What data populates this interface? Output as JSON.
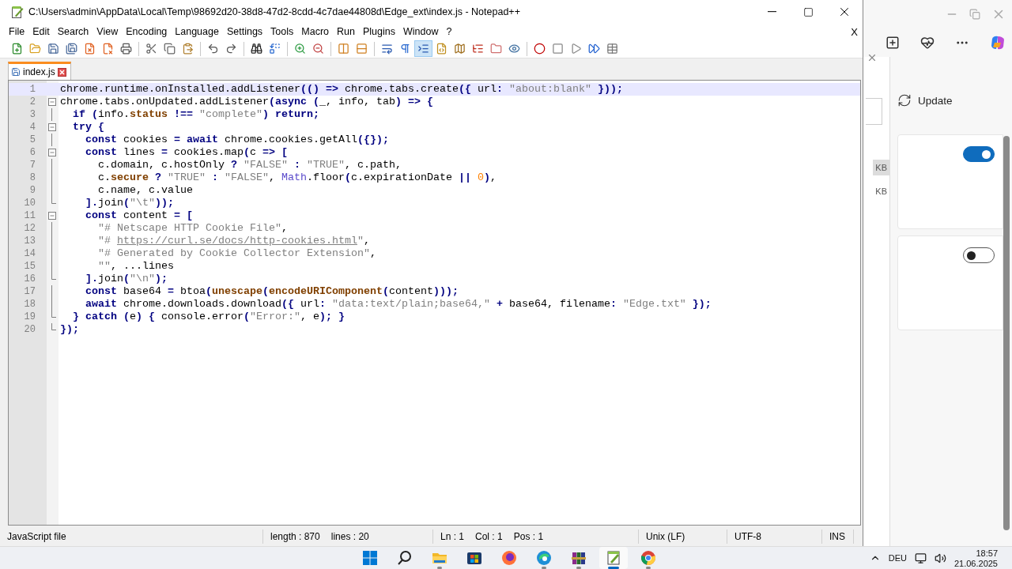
{
  "window": {
    "title": "C:\\Users\\admin\\AppData\\Local\\Temp\\98692d20-38d8-47d2-8cdd-4c7dae44808d\\Edge_ext\\index.js - Notepad++"
  },
  "menu": [
    "File",
    "Edit",
    "Search",
    "View",
    "Encoding",
    "Language",
    "Settings",
    "Tools",
    "Macro",
    "Run",
    "Plugins",
    "Window",
    "?"
  ],
  "menu_close": "X",
  "toolbar": [
    [
      {
        "pressed": false
      },
      {
        "pressed": false
      },
      {
        "pressed": false
      },
      {
        "pressed": false
      },
      {
        "pressed": false
      },
      {
        "pressed": false
      },
      {
        "pressed": false
      }
    ],
    [
      {
        "pressed": false
      },
      {
        "pressed": false
      },
      {
        "pressed": false
      }
    ],
    [
      {
        "pressed": false
      },
      {
        "pressed": false
      }
    ],
    [
      {
        "pressed": false
      },
      {
        "pressed": false
      }
    ],
    [
      {
        "pressed": false
      },
      {
        "pressed": false
      }
    ],
    [
      {
        "pressed": false
      },
      {
        "pressed": false
      }
    ],
    [
      {
        "pressed": false
      },
      {
        "pressed": false
      },
      {
        "pressed": true
      },
      {
        "pressed": false
      },
      {
        "pressed": false
      },
      {
        "pressed": false
      },
      {
        "pressed": false
      },
      {
        "pressed": false
      }
    ],
    [
      {
        "pressed": false
      },
      {
        "pressed": false
      },
      {
        "pressed": false
      },
      {
        "pressed": false
      },
      {
        "pressed": false
      }
    ]
  ],
  "tabs": [
    {
      "label": "index.js",
      "selected": true
    }
  ],
  "editor": {
    "lines": [
      {
        "n": "1",
        "kind": "plain",
        "current": true,
        "tokens": [
          {
            "kind": "plain",
            "text": "chrome.runtime.onInstalled.addListener"
          },
          {
            "kind": "operator",
            "text": "(() => "
          },
          {
            "kind": "plain",
            "text": "chrome.tabs.create"
          },
          {
            "kind": "operator",
            "text": "({ "
          },
          {
            "kind": "plain",
            "text": "url"
          },
          {
            "kind": "operator",
            "text": ": "
          },
          {
            "kind": "string",
            "text": "\"about:blank\""
          },
          {
            "kind": "operator",
            "text": " }));"
          }
        ]
      },
      {
        "n": "2",
        "kind": "header",
        "current": false,
        "tokens": [
          {
            "kind": "plain",
            "text": "chrome.tabs.onUpdated.addListener"
          },
          {
            "kind": "operator",
            "text": "("
          },
          {
            "kind": "keyword",
            "text": "async"
          },
          {
            "kind": "operator",
            "text": " ("
          },
          {
            "kind": "plain",
            "text": "_, info, tab"
          },
          {
            "kind": "operator",
            "text": ") => {"
          }
        ]
      },
      {
        "n": "3",
        "kind": "body",
        "current": false,
        "tokens": [
          {
            "kind": "keyword",
            "text": "  if"
          },
          {
            "kind": "operator",
            "text": " ("
          },
          {
            "kind": "plain",
            "text": "info."
          },
          {
            "kind": "object",
            "text": "status"
          },
          {
            "kind": "operator",
            "text": " !== "
          },
          {
            "kind": "string",
            "text": "\"complete\""
          },
          {
            "kind": "operator",
            "text": ") "
          },
          {
            "kind": "keyword",
            "text": "return"
          },
          {
            "kind": "operator",
            "text": ";"
          }
        ]
      },
      {
        "n": "4",
        "kind": "header",
        "current": false,
        "tokens": [
          {
            "kind": "keyword",
            "text": "  try"
          },
          {
            "kind": "operator",
            "text": " {"
          }
        ]
      },
      {
        "n": "5",
        "kind": "body",
        "current": false,
        "tokens": [
          {
            "kind": "keyword",
            "text": "    const"
          },
          {
            "kind": "plain",
            "text": " cookies "
          },
          {
            "kind": "operator",
            "text": "= "
          },
          {
            "kind": "keyword",
            "text": "await"
          },
          {
            "kind": "plain",
            "text": " chrome.cookies.getAll"
          },
          {
            "kind": "operator",
            "text": "({});"
          }
        ]
      },
      {
        "n": "6",
        "kind": "header",
        "current": false,
        "tokens": [
          {
            "kind": "keyword",
            "text": "    const"
          },
          {
            "kind": "plain",
            "text": " lines "
          },
          {
            "kind": "operator",
            "text": "= "
          },
          {
            "kind": "plain",
            "text": "cookies.map"
          },
          {
            "kind": "operator",
            "text": "("
          },
          {
            "kind": "plain",
            "text": "c "
          },
          {
            "kind": "operator",
            "text": "=> ["
          }
        ]
      },
      {
        "n": "7",
        "kind": "body",
        "current": false,
        "tokens": [
          {
            "kind": "plain",
            "text": "      c.domain, c.hostOnly "
          },
          {
            "kind": "operator",
            "text": "? "
          },
          {
            "kind": "string",
            "text": "\"FALSE\""
          },
          {
            "kind": "operator",
            "text": " : "
          },
          {
            "kind": "string",
            "text": "\"TRUE\""
          },
          {
            "kind": "plain",
            "text": ", c.path,"
          }
        ]
      },
      {
        "n": "8",
        "kind": "body",
        "current": false,
        "tokens": [
          {
            "kind": "plain",
            "text": "      c."
          },
          {
            "kind": "object",
            "text": "secure"
          },
          {
            "kind": "operator",
            "text": " ? "
          },
          {
            "kind": "string",
            "text": "\"TRUE\""
          },
          {
            "kind": "operator",
            "text": " : "
          },
          {
            "kind": "string",
            "text": "\"FALSE\""
          },
          {
            "kind": "plain",
            "text": ", "
          },
          {
            "kind": "builtin",
            "text": "Math"
          },
          {
            "kind": "plain",
            "text": ".floor"
          },
          {
            "kind": "operator",
            "text": "("
          },
          {
            "kind": "plain",
            "text": "c.expirationDate "
          },
          {
            "kind": "operator",
            "text": "|| "
          },
          {
            "kind": "number",
            "text": "0"
          },
          {
            "kind": "operator",
            "text": ")"
          },
          {
            "kind": "plain",
            "text": ","
          }
        ]
      },
      {
        "n": "9",
        "kind": "body",
        "current": false,
        "tokens": [
          {
            "kind": "plain",
            "text": "      c.name, c.value"
          }
        ]
      },
      {
        "n": "10",
        "kind": "footer",
        "current": false,
        "tokens": [
          {
            "kind": "operator",
            "text": "    ]."
          },
          {
            "kind": "plain",
            "text": "join"
          },
          {
            "kind": "operator",
            "text": "("
          },
          {
            "kind": "string",
            "text": "\"\\t\""
          },
          {
            "kind": "operator",
            "text": "));"
          }
        ]
      },
      {
        "n": "11",
        "kind": "header",
        "current": false,
        "tokens": [
          {
            "kind": "keyword",
            "text": "    const"
          },
          {
            "kind": "plain",
            "text": " content "
          },
          {
            "kind": "operator",
            "text": "= ["
          }
        ]
      },
      {
        "n": "12",
        "kind": "body",
        "current": false,
        "tokens": [
          {
            "kind": "string",
            "text": "      \"# Netscape HTTP Cookie File\""
          },
          {
            "kind": "plain",
            "text": ","
          }
        ]
      },
      {
        "n": "13",
        "kind": "body",
        "current": false,
        "tokens": [
          {
            "kind": "string",
            "text": "      \"# "
          },
          {
            "kind": "link",
            "text": "https://curl.se/docs/http-cookies.html"
          },
          {
            "kind": "string",
            "text": "\""
          },
          {
            "kind": "plain",
            "text": ","
          }
        ]
      },
      {
        "n": "14",
        "kind": "body",
        "current": false,
        "tokens": [
          {
            "kind": "string",
            "text": "      \"# Generated by Cookie Collector Extension\""
          },
          {
            "kind": "plain",
            "text": ","
          }
        ]
      },
      {
        "n": "15",
        "kind": "body",
        "current": false,
        "tokens": [
          {
            "kind": "string",
            "text": "      \"\""
          },
          {
            "kind": "plain",
            "text": ", ...lines"
          }
        ]
      },
      {
        "n": "16",
        "kind": "footer",
        "current": false,
        "tokens": [
          {
            "kind": "operator",
            "text": "    ]."
          },
          {
            "kind": "plain",
            "text": "join"
          },
          {
            "kind": "operator",
            "text": "("
          },
          {
            "kind": "string",
            "text": "\"\\n\""
          },
          {
            "kind": "operator",
            "text": ");"
          }
        ]
      },
      {
        "n": "17",
        "kind": "body",
        "current": false,
        "tokens": [
          {
            "kind": "keyword",
            "text": "    const"
          },
          {
            "kind": "plain",
            "text": " base64 "
          },
          {
            "kind": "operator",
            "text": "= "
          },
          {
            "kind": "plain",
            "text": "btoa"
          },
          {
            "kind": "operator",
            "text": "("
          },
          {
            "kind": "object",
            "text": "unescape"
          },
          {
            "kind": "operator",
            "text": "("
          },
          {
            "kind": "object",
            "text": "encodeURIComponent"
          },
          {
            "kind": "operator",
            "text": "("
          },
          {
            "kind": "plain",
            "text": "content"
          },
          {
            "kind": "operator",
            "text": ")));"
          }
        ]
      },
      {
        "n": "18",
        "kind": "body",
        "current": false,
        "tokens": [
          {
            "kind": "keyword",
            "text": "    await"
          },
          {
            "kind": "plain",
            "text": " chrome.downloads.download"
          },
          {
            "kind": "operator",
            "text": "({ "
          },
          {
            "kind": "plain",
            "text": "url"
          },
          {
            "kind": "operator",
            "text": ": "
          },
          {
            "kind": "string",
            "text": "\"data:text/plain;base64,\""
          },
          {
            "kind": "operator",
            "text": " + "
          },
          {
            "kind": "plain",
            "text": "base64, filename"
          },
          {
            "kind": "operator",
            "text": ": "
          },
          {
            "kind": "string",
            "text": "\"Edge.txt\""
          },
          {
            "kind": "operator",
            "text": " });"
          }
        ]
      },
      {
        "n": "19",
        "kind": "footer",
        "current": false,
        "tokens": [
          {
            "kind": "operator",
            "text": "  } "
          },
          {
            "kind": "keyword",
            "text": "catch"
          },
          {
            "kind": "operator",
            "text": " ("
          },
          {
            "kind": "plain",
            "text": "e"
          },
          {
            "kind": "operator",
            "text": ") { "
          },
          {
            "kind": "plain",
            "text": "console.error"
          },
          {
            "kind": "operator",
            "text": "("
          },
          {
            "kind": "string",
            "text": "\"Error:\""
          },
          {
            "kind": "plain",
            "text": ", e"
          },
          {
            "kind": "operator",
            "text": "); }"
          }
        ]
      },
      {
        "n": "20",
        "kind": "footer",
        "current": false,
        "tokens": [
          {
            "kind": "operator",
            "text": "});"
          }
        ]
      }
    ]
  },
  "status_bar": [
    {
      "items": [
        "JavaScript file"
      ]
    },
    {
      "items": [
        "length : 870",
        "lines : 20"
      ]
    },
    {
      "items": [
        "Ln : 1",
        "Col : 1",
        "Pos : 1"
      ]
    },
    {
      "items": [
        "Unix (LF)"
      ]
    },
    {
      "items": [
        "UTF-8"
      ]
    },
    {
      "items": [
        "INS"
      ]
    }
  ],
  "background_window": {
    "update_label": "Update",
    "sizes": [
      {
        "label": "KB",
        "selected": true
      },
      {
        "label": "KB",
        "selected": false
      }
    ],
    "toggles": [
      {
        "on": true
      },
      {
        "on": false
      }
    ]
  },
  "taskbar": {
    "apps": [
      {
        "running": false,
        "selected": false
      },
      {
        "running": false,
        "selected": false
      },
      {
        "running": true,
        "selected": false
      },
      {
        "running": false,
        "selected": false
      },
      {
        "running": false,
        "selected": false
      },
      {
        "running": true,
        "selected": false
      },
      {
        "running": true,
        "selected": false
      },
      {
        "running": true,
        "selected": true
      },
      {
        "running": true,
        "selected": false
      }
    ],
    "language": "DEU",
    "time": "18:57",
    "date": "21.06.2025"
  }
}
